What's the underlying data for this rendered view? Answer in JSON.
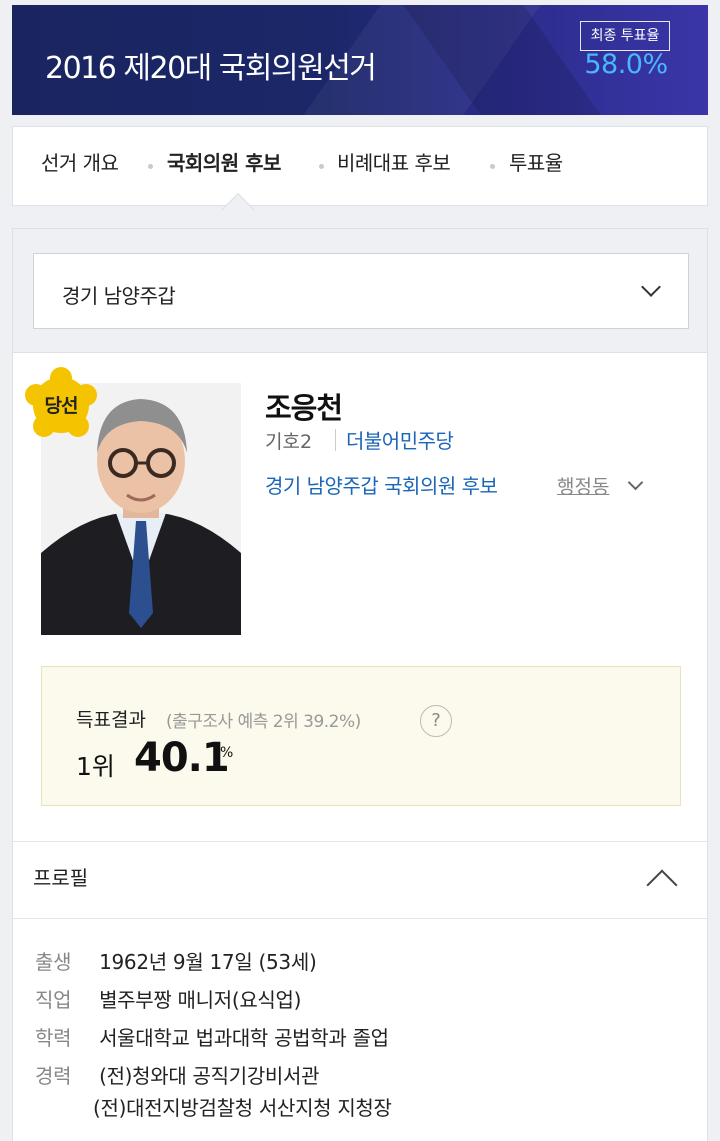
{
  "header": {
    "title": "2016 제20대 국회의원선거",
    "turnout_label": "최종 투표율",
    "turnout_value": "58.0%"
  },
  "tabs": [
    {
      "label": "선거 개요",
      "active": false
    },
    {
      "label": "국회의원 후보",
      "active": true
    },
    {
      "label": "비례대표 후보",
      "active": false
    },
    {
      "label": "투표율",
      "active": false
    }
  ],
  "region_select": {
    "value": "경기 남양주갑"
  },
  "candidate": {
    "badge": "당선",
    "name": "조응천",
    "number": "기호2",
    "party": "더불어민주당",
    "region": "경기 남양주갑 국회의원 후보",
    "admin_link": "행정동"
  },
  "result": {
    "title": "득표결과",
    "exit_poll": "(출구조사 예측 2위 39.2%)",
    "help": "?",
    "rank": "1위",
    "percent": "40.1",
    "percent_sign": "%"
  },
  "profile": {
    "title": "프로필",
    "rows": [
      {
        "key": "출생",
        "value": "1962년 9월 17일 (53세)"
      },
      {
        "key": "직업",
        "value": "별주부짱 매니저(요식업)"
      },
      {
        "key": "학력",
        "value": "서울대학교 법과대학 공법학과 졸업"
      },
      {
        "key": "경력",
        "value": "(전)청와대 공직기강비서관"
      }
    ],
    "career_extra": "(전)대전지방검찰청 서산지청 지청장"
  },
  "colors": {
    "banner": "#1b2768",
    "turnout": "#49b6ff",
    "link_blue": "#1b66b8",
    "badge_yellow": "#f5c400",
    "result_bg": "#fbfaec"
  }
}
